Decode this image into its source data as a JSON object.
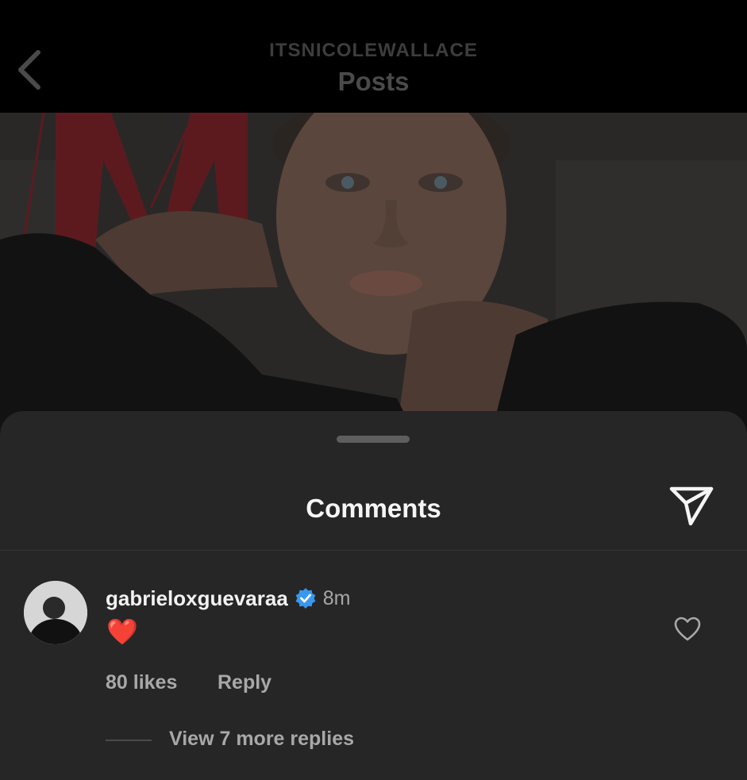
{
  "header": {
    "username": "ITSNICOLEWALLACE",
    "title": "Posts"
  },
  "post": {
    "image_icon": "fashion-portrait-photo"
  },
  "comments_sheet": {
    "title": "Comments",
    "share_icon": "paper-plane-icon"
  },
  "comment": {
    "username": "gabrieloxguevaraa",
    "verified": true,
    "time": "8m",
    "text": "❤️",
    "likes": "80 likes",
    "reply_label": "Reply",
    "view_replies_label": "View 7 more replies"
  },
  "colors": {
    "sheet_bg": "#262626",
    "verified_blue": "#3897f0",
    "heart_red": "#e8202b"
  }
}
